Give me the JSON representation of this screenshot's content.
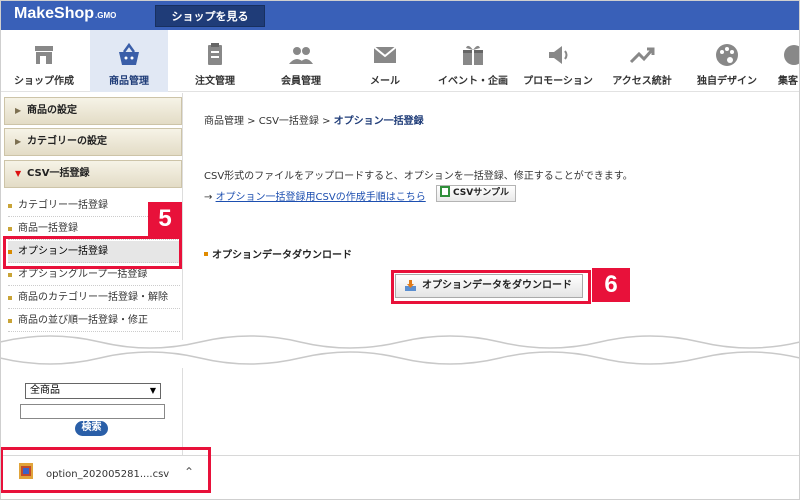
{
  "header": {
    "logo": "MakeShop",
    "logo_suffix": ".GMO",
    "shop_view_button": "ショップを見る"
  },
  "nav": [
    {
      "label": "ショップ作成",
      "icon": "store-icon"
    },
    {
      "label": "商品管理",
      "icon": "basket-icon",
      "active": true
    },
    {
      "label": "注文管理",
      "icon": "clipboard-icon"
    },
    {
      "label": "会員管理",
      "icon": "members-icon"
    },
    {
      "label": "メール",
      "icon": "mail-icon"
    },
    {
      "label": "イベント・企画",
      "icon": "gift-icon"
    },
    {
      "label": "プロモーション",
      "icon": "megaphone-icon"
    },
    {
      "label": "アクセス統計",
      "icon": "trend-icon"
    },
    {
      "label": "独自デザイン",
      "icon": "palette-icon"
    },
    {
      "label": "集客",
      "icon": "partial-icon"
    }
  ],
  "sidebar": {
    "sections": [
      {
        "label": "商品の設定"
      },
      {
        "label": "カテゴリーの設定"
      },
      {
        "label": "CSV一括登録"
      }
    ],
    "items": [
      {
        "label": "カテゴリー一括登録"
      },
      {
        "label": "商品一括登録"
      },
      {
        "label": "オプション一括登録"
      },
      {
        "label": "オプショングループ一括登録"
      },
      {
        "label": "商品のカテゴリー一括登録・解除"
      },
      {
        "label": "商品の並び順一括登録・修正"
      }
    ],
    "select_value": "全商品",
    "search_button": "検索"
  },
  "breadcrumb": {
    "path": "商品管理 > CSV一括登録 > ",
    "current": "オプション一括登録"
  },
  "content": {
    "description": "CSV形式のファイルをアップロードすると、オプションを一括登録、修正することができます。",
    "arrow": "→ ",
    "guide_link": "オプション一括登録用CSVの作成手順はこちら",
    "csv_sample_button": "CSVサンプル",
    "section_title": "オプションデータダウンロード",
    "download_button": "オプションデータをダウンロード"
  },
  "annotations": {
    "badge_5": "5",
    "badge_6": "6"
  },
  "download_shelf": {
    "file_name": "option_202005281....csv"
  },
  "colors": {
    "header_blue": "#3960b8",
    "annotation_red": "#e8113a"
  }
}
